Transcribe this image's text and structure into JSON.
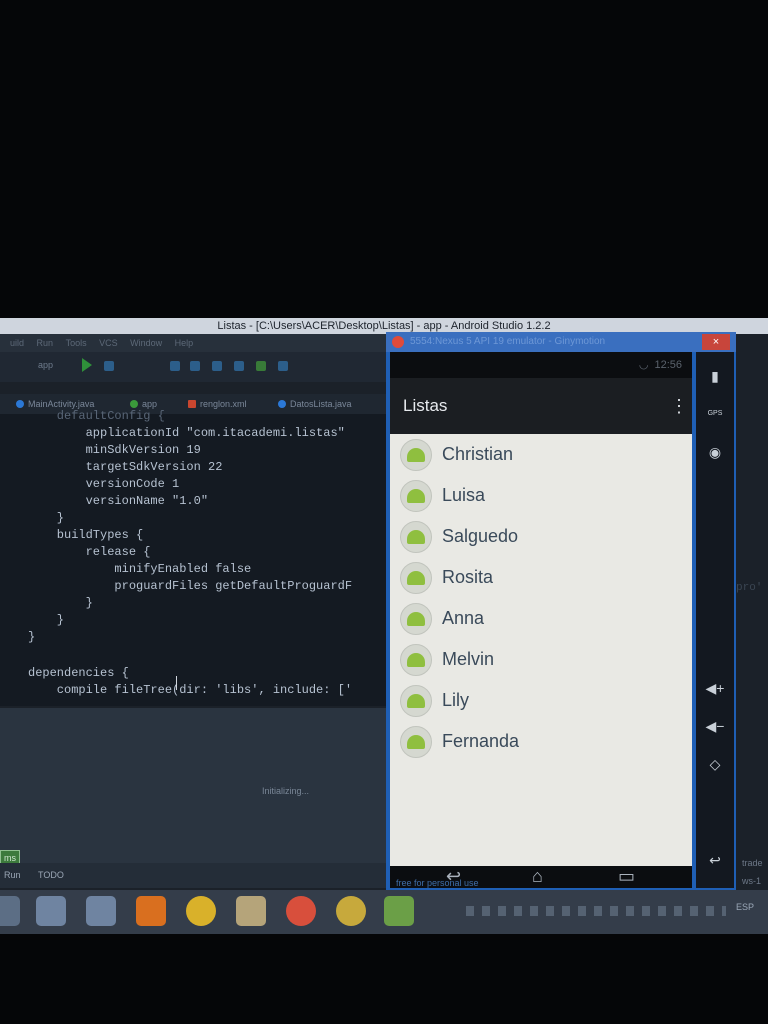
{
  "ide": {
    "window_title": "Listas - [C:\\Users\\ACER\\Desktop\\Listas] - app - Android Studio 1.2.2",
    "menu": [
      "uild",
      "Run",
      "Tools",
      "VCS",
      "Window",
      "Help"
    ],
    "run_config": "app",
    "tabs": [
      {
        "label": "MainActivity.java"
      },
      {
        "label": "app"
      },
      {
        "label": "renglon.xml"
      },
      {
        "label": "DatosLista.java"
      }
    ],
    "code_lines": [
      "    defaultConfig {",
      "        applicationId \"com.itacademi.listas\"",
      "        minSdkVersion 19",
      "        targetSdkVersion 22",
      "        versionCode 1",
      "        versionName \"1.0\"",
      "    }",
      "    buildTypes {",
      "        release {",
      "            minifyEnabled false",
      "            proguardFiles getDefaultProguardF",
      "        }",
      "    }",
      "}",
      "",
      "dependencies {",
      "    compile fileTree(dir: 'libs', include: ['"
    ],
    "status_text": "Initializing...",
    "bottom_tabs": [
      "Run",
      "TODO"
    ],
    "right_fragment": "pro'",
    "side_fragments": [
      "trade",
      "ws-1"
    ],
    "process_badge": "ms"
  },
  "emulator": {
    "window_title": "5554:Nexus 5 API 19 emulator - Ginymotion",
    "close_label": "×",
    "status_time": "12:56",
    "app_title": "Listas",
    "overflow_icon": "⋮",
    "list_items": [
      "Christian",
      "Luisa",
      "Salguedo",
      "Rosita",
      "Anna",
      "Melvin",
      "Lily",
      "Fernanda"
    ],
    "side_controls": [
      "battery-icon",
      "gps-icon",
      "camera-icon",
      "volume-up-icon",
      "volume-down-icon",
      "rotate-icon",
      "back-icon"
    ],
    "gps_label": "GPS",
    "footer_text": "free for personal use"
  },
  "taskbar": {
    "icons": [
      "virtualbox-icon",
      "virtualbox-icon",
      "virtualbox-icon",
      "xampp-icon",
      "chrome-icon",
      "file-explorer-icon",
      "genymotion-icon",
      "chrome-icon",
      "android-studio-icon"
    ],
    "language": "ESP"
  },
  "colors": {
    "ide_bg": "#141a22",
    "emu_frame": "#1f5fb5",
    "list_bg": "#e9e9e4",
    "action_bar": "#1b1e22"
  }
}
